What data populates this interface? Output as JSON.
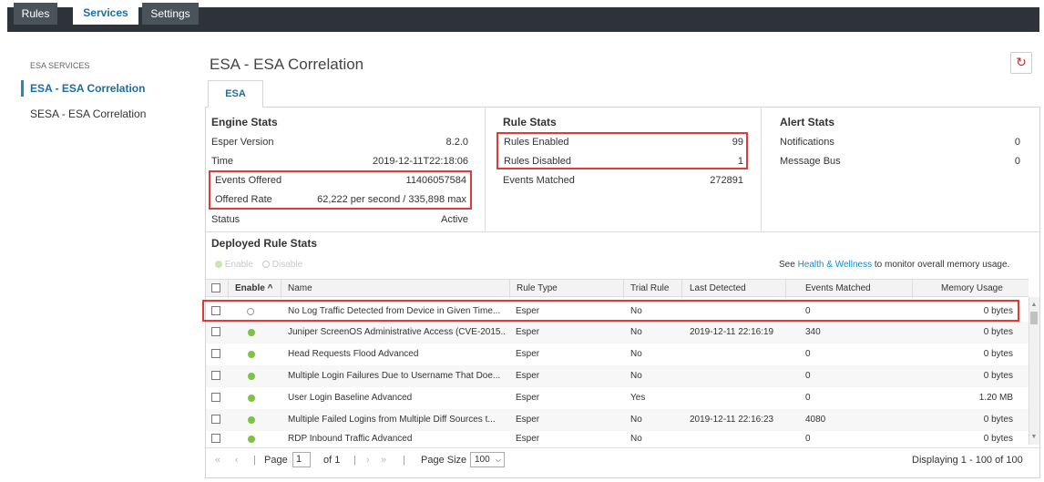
{
  "tabs": [
    "Rules",
    "Services",
    "Settings"
  ],
  "sidebar": {
    "heading": "ESA SERVICES",
    "items": [
      "ESA - ESA Correlation",
      "SESA - ESA Correlation"
    ]
  },
  "main": {
    "title": "ESA - ESA Correlation",
    "subtab": "ESA"
  },
  "engine_stats": {
    "title": "Engine Stats",
    "rows": [
      {
        "label": "Esper Version",
        "value": "8.2.0"
      },
      {
        "label": "Time",
        "value": "2019-12-11T22:18:06"
      },
      {
        "label": "Events Offered",
        "value": "11406057584"
      },
      {
        "label": "Offered Rate",
        "value": "62,222 per second / 335,898 max"
      },
      {
        "label": "Status",
        "value": "Active"
      }
    ]
  },
  "rule_stats": {
    "title": "Rule Stats",
    "rows": [
      {
        "label": "Rules Enabled",
        "value": "99"
      },
      {
        "label": "Rules Disabled",
        "value": "1"
      },
      {
        "label": "Events Matched",
        "value": "272891"
      }
    ]
  },
  "alert_stats": {
    "title": "Alert Stats",
    "rows": [
      {
        "label": "Notifications",
        "value": "0"
      },
      {
        "label": "Message Bus",
        "value": "0"
      }
    ]
  },
  "deployed": {
    "title": "Deployed Rule Stats",
    "enable_label": "Enable",
    "disable_label": "Disable",
    "health_prefix": "See",
    "health_link": "Health & Wellness",
    "health_suffix": "to monitor overall memory usage."
  },
  "columns": [
    "Enable ^",
    "Name",
    "Rule Type",
    "Trial Rule",
    "Last Detected",
    "Events Matched",
    "Memory Usage"
  ],
  "rows": [
    {
      "enabled": false,
      "name": "No Log Traffic Detected from Device in Given Time...",
      "type": "Esper",
      "trial": "No",
      "last": "",
      "matched": "0",
      "memory": "0 bytes"
    },
    {
      "enabled": true,
      "name": "Juniper ScreenOS Administrative Access (CVE-2015...",
      "type": "Esper",
      "trial": "No",
      "last": "2019-12-11 22:16:19",
      "matched": "340",
      "memory": "0 bytes"
    },
    {
      "enabled": true,
      "name": "Head Requests Flood Advanced",
      "type": "Esper",
      "trial": "No",
      "last": "",
      "matched": "0",
      "memory": "0 bytes"
    },
    {
      "enabled": true,
      "name": "Multiple Login Failures Due to Username That Doe...",
      "type": "Esper",
      "trial": "No",
      "last": "",
      "matched": "0",
      "memory": "0 bytes"
    },
    {
      "enabled": true,
      "name": "User Login Baseline Advanced",
      "type": "Esper",
      "trial": "Yes",
      "last": "",
      "matched": "0",
      "memory": "1.20 MB"
    },
    {
      "enabled": true,
      "name": "Multiple Failed Logins from Multiple Diff Sources t...",
      "type": "Esper",
      "trial": "No",
      "last": "2019-12-11 22:16:23",
      "matched": "4080",
      "memory": "0 bytes"
    },
    {
      "enabled": true,
      "name": "RDP Inbound Traffic Advanced",
      "type": "Esper",
      "trial": "No",
      "last": "",
      "matched": "0",
      "memory": "0 bytes"
    }
  ],
  "pager": {
    "page_label": "Page",
    "page_value": "1",
    "of_label": "of 1",
    "size_label": "Page Size",
    "size_value": "100",
    "display": "Displaying 1 - 100 of 100"
  },
  "colors": {
    "accent": "#1a8bc4",
    "highlight": "#e53935",
    "enabled_dot": "#7dc242"
  }
}
